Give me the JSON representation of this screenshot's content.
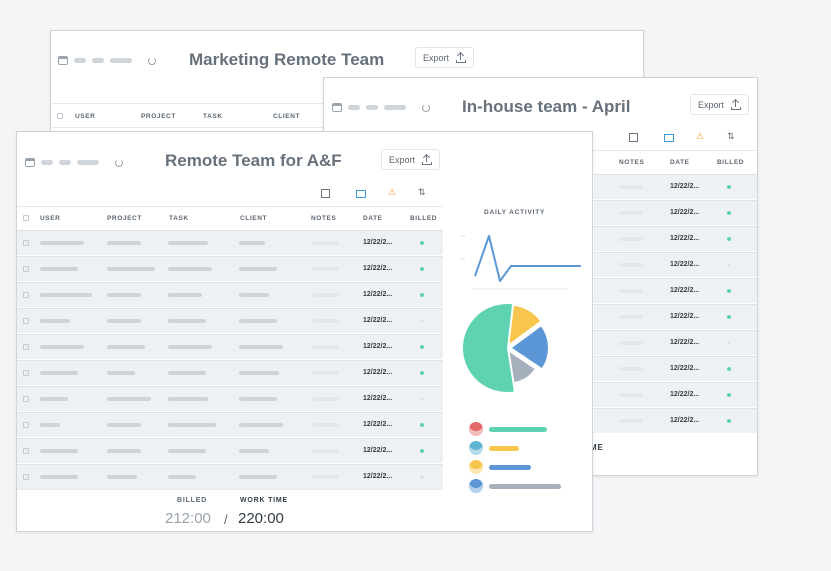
{
  "back_card": {
    "title": "Marketing Remote Team",
    "export_label": "Export",
    "columns": [
      "USER",
      "PROJECT",
      "TASK",
      "CLIENT"
    ]
  },
  "mid_card": {
    "title": "In-house team - April",
    "export_label": "Export",
    "columns": [
      "NOTES",
      "DATE",
      "BILLED"
    ],
    "dates": [
      "12/22/2...",
      "12/22/2...",
      "12/22/2...",
      "12/22/2...",
      "12/22/2...",
      "12/22/2...",
      "12/22/2...",
      "12/22/2...",
      "12/22/2...",
      "12/22/2..."
    ],
    "billed": [
      true,
      true,
      true,
      false,
      true,
      true,
      false,
      true,
      true,
      true
    ],
    "footer_partial": "ME"
  },
  "front_card": {
    "title": "Remote Team for A&F",
    "export_label": "Export",
    "columns": [
      "USER",
      "PROJECT",
      "TASK",
      "CLIENT",
      "NOTES",
      "DATE",
      "BILLED"
    ],
    "dates": [
      "12/22/2...",
      "12/22/2...",
      "12/22/2...",
      "12/22/2...",
      "12/22/2...",
      "12/22/2...",
      "12/22/2...",
      "12/22/2...",
      "12/22/2...",
      "12/22/2..."
    ],
    "billed": [
      true,
      true,
      true,
      false,
      true,
      true,
      false,
      true,
      true,
      false
    ],
    "footer": {
      "billed_label": "BILLED",
      "billed_value": "212:00",
      "separator": "/",
      "worktime_label": "WORK TIME",
      "worktime_value": "220:00"
    },
    "daily_activity_label": "DAILY ACTIVITY"
  },
  "colors": {
    "green": "#5fd3b1",
    "yellow": "#f8c64c",
    "blue": "#5b97d6",
    "grey": "#a6b0bc",
    "orange": "#f0a030",
    "accent_blue": "#3c9bd5"
  },
  "icons": [
    "calendar-icon",
    "refresh-icon",
    "export-upload-icon",
    "notes-list-icon",
    "columns-icon",
    "warning-icon",
    "sort-icon",
    "avatar-icon"
  ],
  "chart_data": [
    {
      "type": "line",
      "title": "DAILY ACTIVITY",
      "x": [
        1,
        2,
        3,
        4,
        5,
        6
      ],
      "values": [
        2,
        10,
        1,
        4,
        4,
        4
      ]
    },
    {
      "type": "pie",
      "values": [
        50,
        12,
        18,
        12
      ],
      "colors": [
        "#5fd3b1",
        "#f8c64c",
        "#5b97d6",
        "#a6b0bc"
      ]
    }
  ]
}
